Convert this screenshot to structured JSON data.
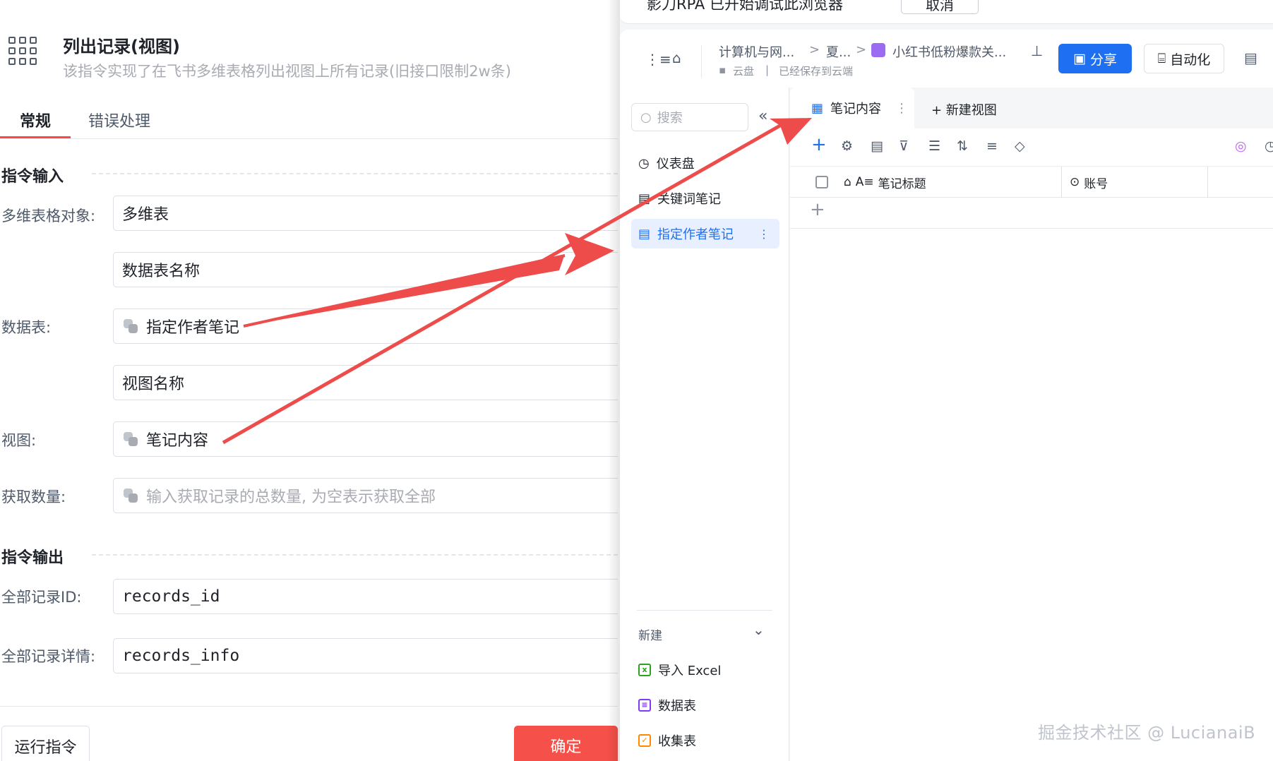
{
  "dialog": {
    "title": "列出记录(视图)",
    "subtitle": "该指令实现了在飞书多维表格列出视图上所有记录(旧接口限制2w条)",
    "tabs": [
      "常规",
      "错误处理"
    ],
    "input_section": "指令输入",
    "output_section": "指令输出",
    "fields": {
      "table_obj_label": "多维表格对象:",
      "table_obj_value": "多维表",
      "datatable_name_value": "数据表名称",
      "datatable_label": "数据表:",
      "datatable_value": "指定作者笔记",
      "view_name_value": "视图名称",
      "view_label": "视图:",
      "view_value": "笔记内容",
      "count_label": "获取数量:",
      "count_placeholder": "输入获取记录的总数量, 为空表示获取全部",
      "ids_label": "全部记录ID:",
      "ids_value": "records_id",
      "info_label": "全部记录详情:",
      "info_value": "records_info"
    },
    "run_button": "运行指令",
    "ok_button": "确定"
  },
  "bitable": {
    "banner_text": "影刀RPA 已开始调试此浏览器",
    "banner_button": "取消",
    "breadcrumb": {
      "item1": "计算机与网...",
      "sep1": ">",
      "item2": "夏...",
      "sep2": ">",
      "doc_title": "小红书低粉爆款关...",
      "location": "云盘",
      "save_status": "已经保存到云端"
    },
    "share_button": "分享",
    "automation_button": "自动化",
    "search_placeholder": "搜索",
    "nav_items": [
      "仪表盘",
      "关键词笔记",
      "指定作者笔记"
    ],
    "new_section": "新建",
    "new_items": [
      "导入 Excel",
      "数据表",
      "收集表"
    ],
    "view_tab": "笔记内容",
    "new_view": "+ 新建视图",
    "columns": [
      "笔记标题",
      "账号"
    ],
    "colors": {
      "accent": "#1e6ff1",
      "danger": "#f5504a",
      "arrow": "#ee4b4b"
    }
  },
  "watermark": "掘金技术社区 @ LucianaiB"
}
